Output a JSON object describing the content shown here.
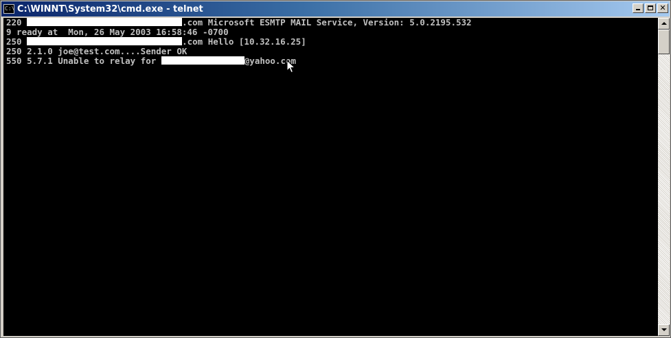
{
  "window": {
    "title": "C:\\WINNT\\System32\\cmd.exe - telnet",
    "icon_name": "cmd-window-icon",
    "icon_glyph": "C:\\",
    "buttons": {
      "minimize_icon": "minimize-icon",
      "maximize_icon": "maximize-icon",
      "close_icon": "close-icon",
      "close_glyph": "✕"
    },
    "colors": {
      "titlebar_start": "#0a246a",
      "titlebar_end": "#a6caf0",
      "console_bg": "#000000",
      "console_text": "#c0c0c0"
    }
  },
  "console": {
    "lines": [
      {
        "pre": "220 ",
        "redacted": true,
        "post": ".com Microsoft ESMTP MAIL Service, Version: 5.0.2195.532"
      },
      {
        "pre": "9 ready at  Mon, 26 May 2003 16:58:46 -0700",
        "redacted": false,
        "post": ""
      },
      {
        "pre": "250 ",
        "redacted": true,
        "post": ".com Hello [10.32.16.25]"
      },
      {
        "pre": "250 2.1.0 joe@test.com....Sender OK",
        "redacted": false,
        "post": ""
      },
      {
        "pre": "550 5.7.1 Unable to relay for ",
        "redacted": true,
        "post": "@yahoo.com"
      }
    ]
  }
}
